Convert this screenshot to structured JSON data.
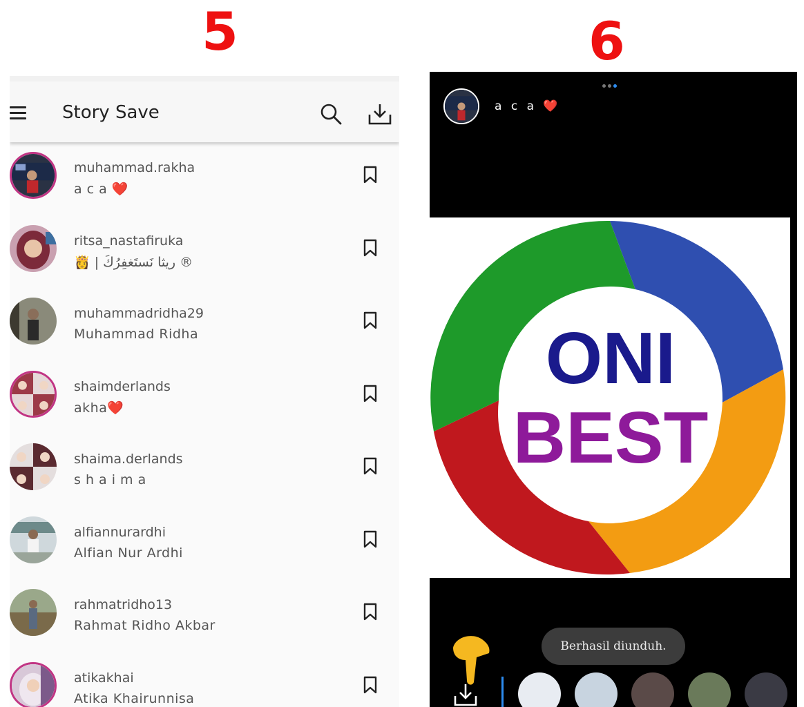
{
  "annotations": {
    "left_number": "5",
    "right_number": "6"
  },
  "app": {
    "title": "Story Save"
  },
  "accounts": [
    {
      "username": "muhammad.rakha",
      "display_name": "a c a ❤️"
    },
    {
      "username": "ritsa_nastafiruka",
      "display_name": "👸 | ريثا نَستَغفِرُكَ ®"
    },
    {
      "username": "muhammadridha29",
      "display_name": "Muhammad Ridha"
    },
    {
      "username": "shaimderlands",
      "display_name": "akha❤️"
    },
    {
      "username": "shaima.derlands",
      "display_name": "s h a i m a"
    },
    {
      "username": "alfiannurardhi",
      "display_name": "Alfian Nur Ardhi"
    },
    {
      "username": "rahmatridho13",
      "display_name": "Rahmat Ridho Akbar"
    },
    {
      "username": "atikakhai",
      "display_name": "Atika Khairunnisa"
    }
  ],
  "story": {
    "user_display": "a c a ❤️",
    "logo_line1": "ONI",
    "logo_line2": "BEST",
    "toast": "Berhasil diunduh."
  },
  "colors": {
    "annotation": "#ee1111",
    "story_bg": "#000000",
    "toast_bg": "#3c3c3c",
    "accent": "#2d8cf0"
  }
}
